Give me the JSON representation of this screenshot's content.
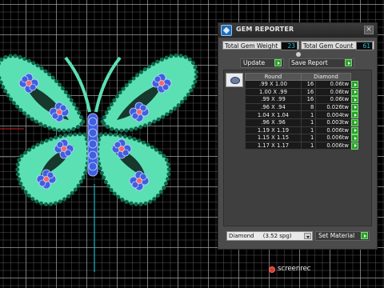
{
  "panel": {
    "title": "GEM REPORTER",
    "close_glyph": "×",
    "total_weight_label": "Total Gem Weight",
    "total_weight_value": "23",
    "total_count_label": "Total Gem Count",
    "total_count_value": "61",
    "update_label": "Update",
    "save_report_label": "Save Report",
    "table": {
      "headers": [
        "Round",
        "Diamond"
      ],
      "rows": [
        {
          "size": ".99 X 1.00",
          "count": "16",
          "weight": "0.06tw"
        },
        {
          "size": "1.00 X .99",
          "count": "16",
          "weight": "0.06tw"
        },
        {
          "size": ".99 X .99",
          "count": "16",
          "weight": "0.06tw"
        },
        {
          "size": ".96 X .94",
          "count": "8",
          "weight": "0.026tw"
        },
        {
          "size": "1.04 X 1.04",
          "count": "1",
          "weight": "0.004tw"
        },
        {
          "size": ".96 X .96",
          "count": "1",
          "weight": "0.003tw"
        },
        {
          "size": "1.19 X 1.19",
          "count": "1",
          "weight": "0.006tw"
        },
        {
          "size": "1.15 X 1.15",
          "count": "1",
          "weight": "0.006tw"
        },
        {
          "size": "1.17 X 1.17",
          "count": "1",
          "weight": "0.006tw"
        }
      ]
    },
    "material_select_value": "Diamond     (3.52 spg)",
    "set_material_label": "Set Material"
  },
  "watermark": {
    "brand": "screenrec"
  },
  "colors": {
    "body": "#5be0b4",
    "bead": "#0f6b4e",
    "stone": "#3f5fe0",
    "stone_center": "#f06a6a",
    "accent_green": "#27a327",
    "value_cyan": "#22c2d6"
  }
}
